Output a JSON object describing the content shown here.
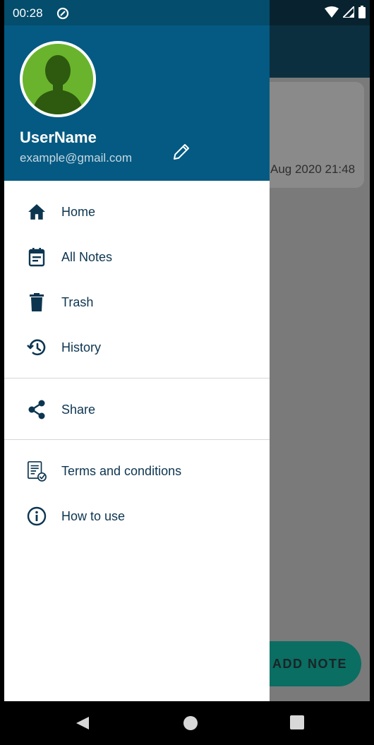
{
  "status_bar": {
    "time": "00:28"
  },
  "background_app": {
    "note_date": "Aug 2020 21:48",
    "fab_label": "ADD NOTE"
  },
  "drawer": {
    "header": {
      "user_name": "UserName",
      "user_email": "example@gmail.com"
    },
    "menu": {
      "home": "Home",
      "all_notes": "All Notes",
      "trash": "Trash",
      "history": "History",
      "share": "Share",
      "terms": "Terms and conditions",
      "how_to_use": "How to use"
    }
  },
  "colors": {
    "header_bg": "#045a82",
    "avatar_bg": "#6ab42d",
    "menu_text": "#0c3550"
  }
}
